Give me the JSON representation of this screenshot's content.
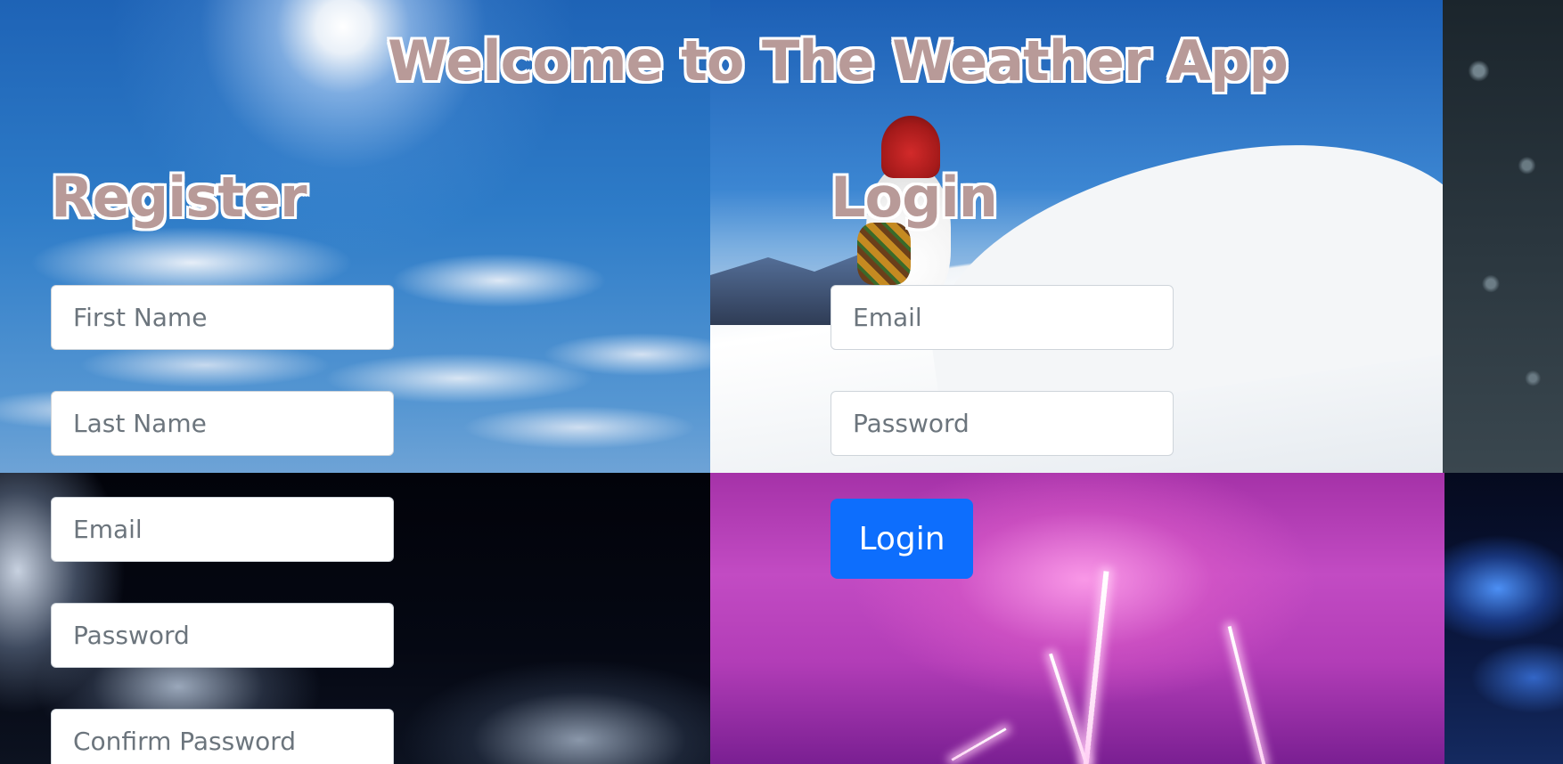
{
  "page": {
    "title": "Welcome to The Weather App"
  },
  "register": {
    "heading": "Register",
    "fields": {
      "first_name_placeholder": "First Name",
      "last_name_placeholder": "Last Name",
      "email_placeholder": "Email",
      "password_placeholder": "Password",
      "confirm_password_placeholder": "Confirm Password"
    }
  },
  "login": {
    "heading": "Login",
    "fields": {
      "email_placeholder": "Email",
      "password_placeholder": "Password"
    },
    "button_label": "Login"
  },
  "colors": {
    "heading_fill": "#b89a98",
    "heading_outline": "#ffffff",
    "button_primary": "#0d6efd"
  },
  "background_tiles": [
    "sunny-sky",
    "snowman-snow",
    "storm-clouds",
    "purple-lightning",
    "rain-on-glass",
    "night-storm"
  ]
}
